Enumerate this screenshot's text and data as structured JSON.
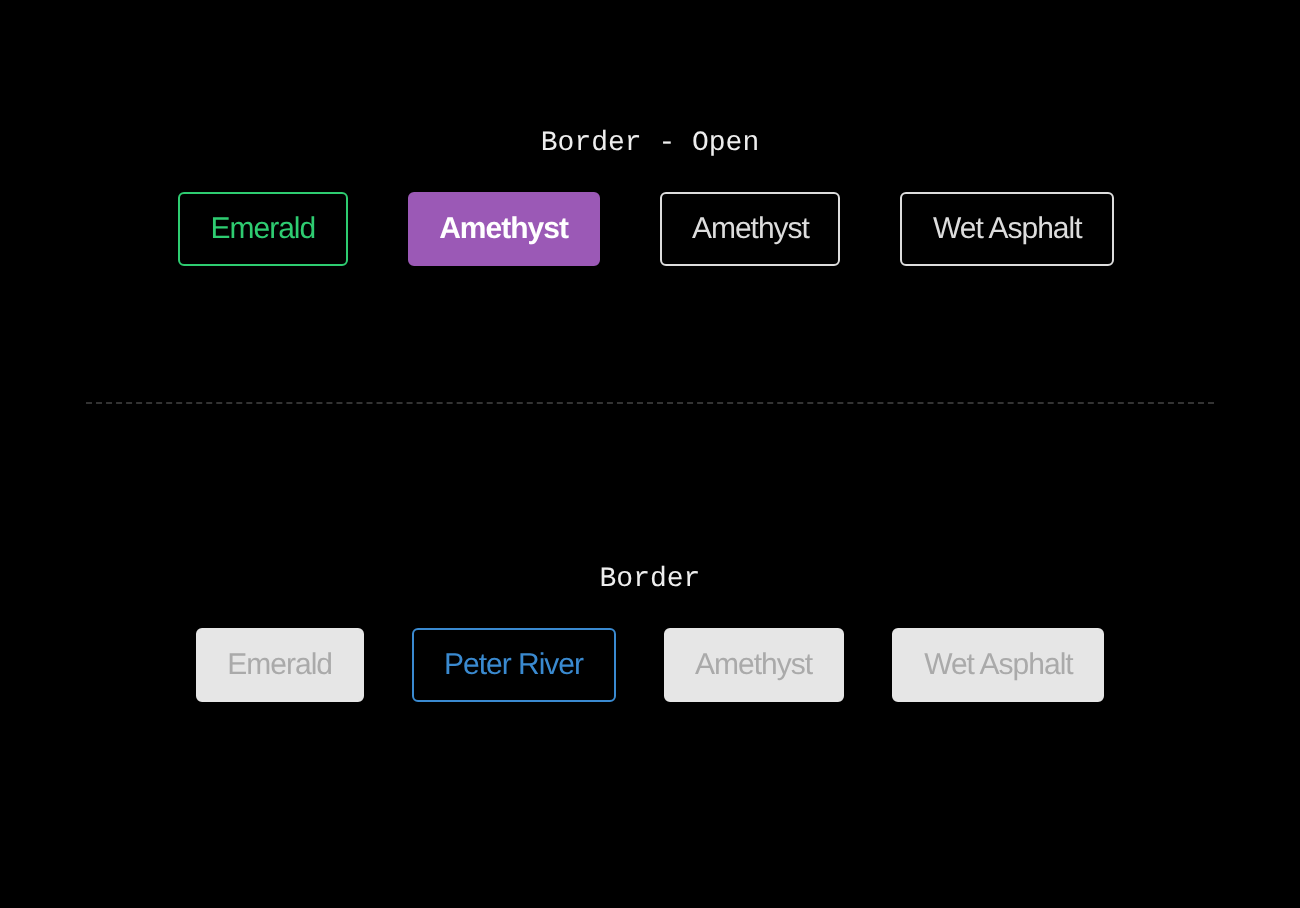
{
  "sections": [
    {
      "title": "Border - Open",
      "buttons": [
        {
          "label": "Emerald",
          "kind": "outline",
          "color": "#2ecc71"
        },
        {
          "label": "Amethyst",
          "kind": "filled",
          "color": "#9b59b6"
        },
        {
          "label": "Amethyst",
          "kind": "outline",
          "color": "#dddddd"
        },
        {
          "label": "Wet Asphalt",
          "kind": "outline",
          "color": "#dddddd"
        }
      ]
    },
    {
      "title": "Border",
      "buttons": [
        {
          "label": "Emerald",
          "kind": "muted",
          "color": "#e6e6e6"
        },
        {
          "label": "Peter River",
          "kind": "outline",
          "color": "#3a8ad0"
        },
        {
          "label": "Amethyst",
          "kind": "muted",
          "color": "#e6e6e6"
        },
        {
          "label": "Wet Asphalt",
          "kind": "muted",
          "color": "#e6e6e6"
        }
      ]
    }
  ]
}
